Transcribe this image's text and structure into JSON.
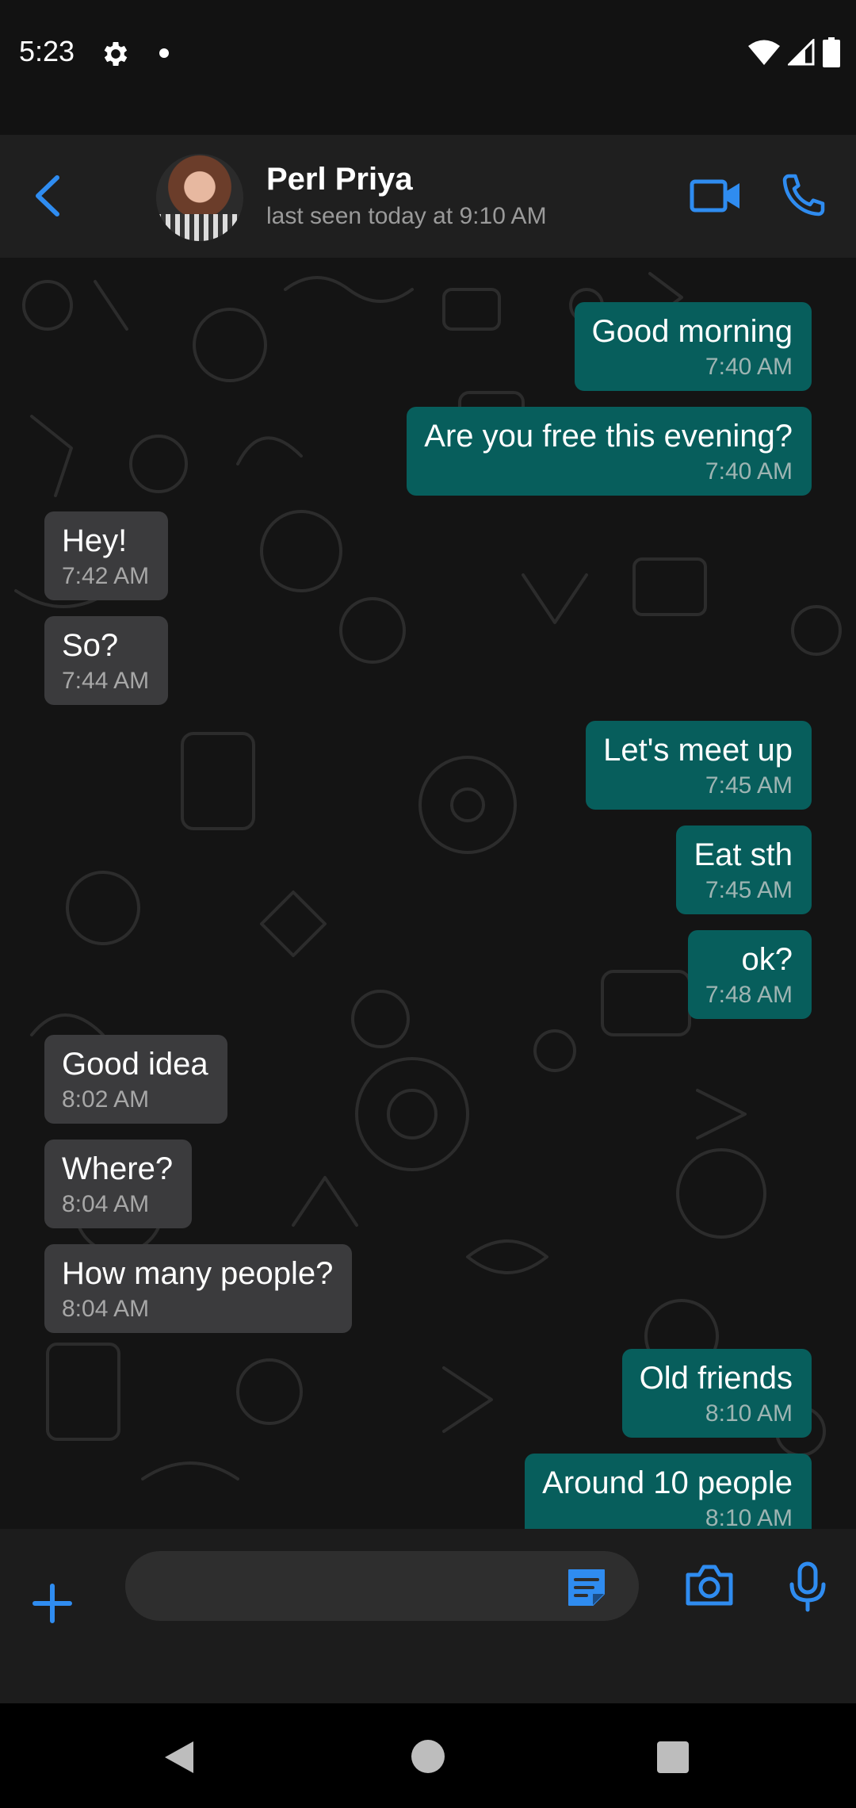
{
  "status_bar": {
    "time": "5:23",
    "icons": [
      "settings-gear-icon",
      "notification-dot-icon",
      "wifi-icon",
      "cell-signal-icon",
      "battery-icon"
    ]
  },
  "header": {
    "contact_name": "Perl Priya",
    "last_seen": "last seen today at 9:10 AM",
    "icons": [
      "back-chevron-icon",
      "video-camera-icon",
      "phone-icon"
    ]
  },
  "colors": {
    "accent": "#2f8cf0",
    "outgoing_bubble": "#075e5c",
    "incoming_bubble": "#3b3b3d",
    "background": "#141414"
  },
  "messages": [
    {
      "dir": "out",
      "text": "Good morning",
      "time": "7:40 AM"
    },
    {
      "dir": "out",
      "text": "Are you free this evening?",
      "time": "7:40 AM"
    },
    {
      "dir": "in",
      "text": "Hey!",
      "time": "7:42 AM"
    },
    {
      "dir": "in",
      "text": "So?",
      "time": "7:44 AM"
    },
    {
      "dir": "out",
      "text": "Let's meet up",
      "time": "7:45 AM"
    },
    {
      "dir": "out",
      "text": "Eat sth",
      "time": "7:45 AM"
    },
    {
      "dir": "out",
      "text": "ok?",
      "time": "7:48 AM"
    },
    {
      "dir": "in",
      "text": "Good idea",
      "time": "8:02 AM"
    },
    {
      "dir": "in",
      "text": "Where?",
      "time": "8:04 AM"
    },
    {
      "dir": "in",
      "text": "How many people?",
      "time": "8:04 AM"
    },
    {
      "dir": "out",
      "text": "Old friends",
      "time": "8:10 AM"
    },
    {
      "dir": "out",
      "text": "Around 10 people",
      "time": "8:10 AM"
    }
  ],
  "composer": {
    "value": "",
    "icons": [
      "plus-icon",
      "sticker-icon",
      "camera-icon",
      "microphone-icon"
    ]
  },
  "nav_bar": {
    "icons": [
      "nav-back-icon",
      "nav-home-icon",
      "nav-recents-icon"
    ]
  }
}
